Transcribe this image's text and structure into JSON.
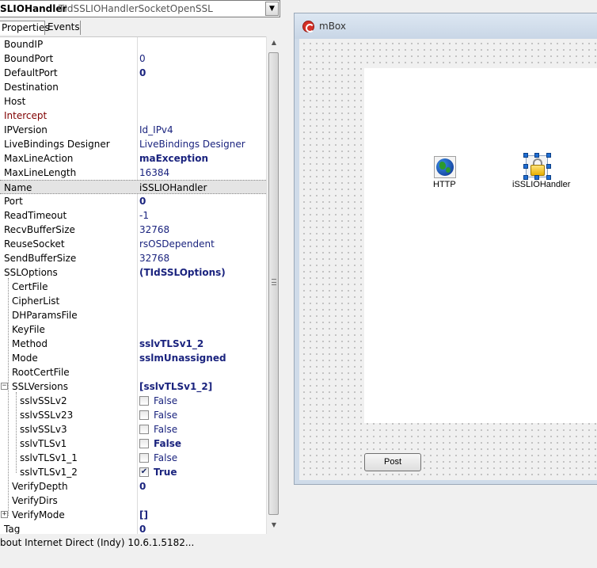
{
  "inspector": {
    "component_name": "SLIOHandler",
    "component_type": "TIdSSLIOHandlerSocketOpenSSL",
    "tabs": [
      {
        "label": "Properties"
      },
      {
        "label": "Events"
      }
    ],
    "properties": [
      {
        "name": "BoundIP",
        "value": ""
      },
      {
        "name": "BoundPort",
        "value": "0"
      },
      {
        "name": "DefaultPort",
        "value": "0",
        "bold": true
      },
      {
        "name": "Destination",
        "value": ""
      },
      {
        "name": "Host",
        "value": ""
      },
      {
        "name": "Intercept",
        "value": "",
        "name_color": "red"
      },
      {
        "name": "IPVersion",
        "value": "Id_IPv4"
      },
      {
        "name": "LiveBindings Designer",
        "value": "LiveBindings Designer"
      },
      {
        "name": "MaxLineAction",
        "value": "maException",
        "bold": true
      },
      {
        "name": "MaxLineLength",
        "value": "16384"
      },
      {
        "name": "Name",
        "value": "iSSLIOHandler",
        "selected": true
      },
      {
        "name": "Port",
        "value": "0",
        "bold": true
      },
      {
        "name": "ReadTimeout",
        "value": "-1"
      },
      {
        "name": "RecvBufferSize",
        "value": "32768"
      },
      {
        "name": "ReuseSocket",
        "value": "rsOSDependent"
      },
      {
        "name": "SendBufferSize",
        "value": "32768"
      },
      {
        "name": "SSLOptions",
        "value": "(TIdSSLOptions)",
        "bold": true
      },
      {
        "name": "CertFile",
        "value": "",
        "indent": 1
      },
      {
        "name": "CipherList",
        "value": "",
        "indent": 1
      },
      {
        "name": "DHParamsFile",
        "value": "",
        "indent": 1
      },
      {
        "name": "KeyFile",
        "value": "",
        "indent": 1
      },
      {
        "name": "Method",
        "value": "sslvTLSv1_2",
        "bold": true,
        "indent": 1
      },
      {
        "name": "Mode",
        "value": "sslmUnassigned",
        "bold": true,
        "indent": 1
      },
      {
        "name": "RootCertFile",
        "value": "",
        "indent": 1
      },
      {
        "name": "SSLVersions",
        "value": "[sslvTLSv1_2]",
        "bold": true,
        "indent": 1,
        "expander": "minus"
      },
      {
        "name": "sslvSSLv2",
        "value": "False",
        "indent": 2,
        "checkbox": false
      },
      {
        "name": "sslvSSLv23",
        "value": "False",
        "indent": 2,
        "checkbox": false
      },
      {
        "name": "sslvSSLv3",
        "value": "False",
        "indent": 2,
        "checkbox": false
      },
      {
        "name": "sslvTLSv1",
        "value": "False",
        "bold": true,
        "indent": 2,
        "checkbox": false
      },
      {
        "name": "sslvTLSv1_1",
        "value": "False",
        "indent": 2,
        "checkbox": false
      },
      {
        "name": "sslvTLSv1_2",
        "value": "True",
        "bold": true,
        "indent": 2,
        "checkbox": true
      },
      {
        "name": "VerifyDepth",
        "value": "0",
        "bold": true,
        "indent": 1
      },
      {
        "name": "VerifyDirs",
        "value": "",
        "indent": 1
      },
      {
        "name": "VerifyMode",
        "value": "[]",
        "bold": true,
        "indent": 1,
        "expander": "plus"
      },
      {
        "name": "Tag",
        "value": "0",
        "bold": true
      }
    ],
    "status_text": "bout Internet Direct (Indy) 10.6.1.5182..."
  },
  "designer": {
    "form_caption": "mBox",
    "components": [
      {
        "label": "HTTP",
        "icon": "globe-icon"
      },
      {
        "label": "iSSLIOHandler",
        "icon": "lock-icon"
      }
    ],
    "post_button_label": "Post"
  },
  "colors": {
    "value_text": "#1a237e",
    "event_link": "#800000",
    "selection_handles": "#1f6ed4",
    "form_title_bg": "#cfdbe9"
  }
}
